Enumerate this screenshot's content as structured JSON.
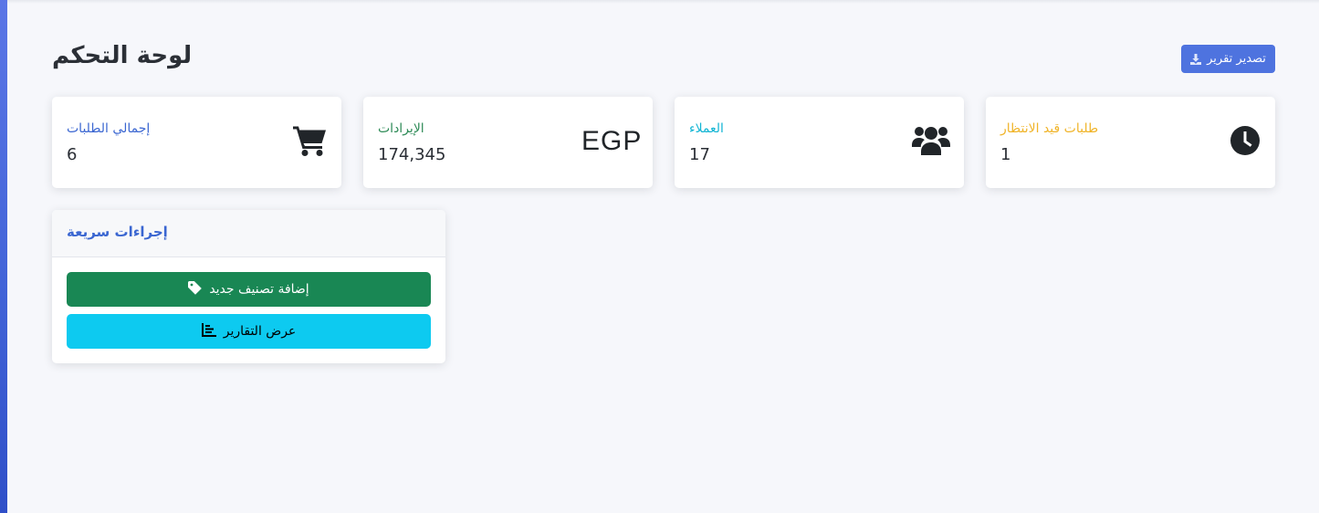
{
  "header": {
    "title": "لوحة التحكم",
    "export_label": "تصدير تقرير"
  },
  "stats": [
    {
      "label": "إجمالي الطلبات",
      "value": "6",
      "color": "#3a66d1",
      "icon": "cart-icon"
    },
    {
      "label": "الإيرادات",
      "value": "174,345",
      "color": "#2e8b57",
      "icon": "currency-icon",
      "icon_text": "EGP"
    },
    {
      "label": "العملاء",
      "value": "17",
      "color": "#12b5d4",
      "icon": "users-icon"
    },
    {
      "label": "طلبات قيد الانتظار",
      "value": "1",
      "color": "#f0b429",
      "icon": "clock-icon"
    }
  ],
  "quick_actions": {
    "title": "إجراءات سريعة",
    "add_category_label": "إضافة تصنيف جديد",
    "view_reports_label": "عرض التقارير"
  },
  "colors": {
    "primary": "#4e73df",
    "success": "#198754",
    "info": "#0dcaf0",
    "warning": "#f0b429"
  }
}
